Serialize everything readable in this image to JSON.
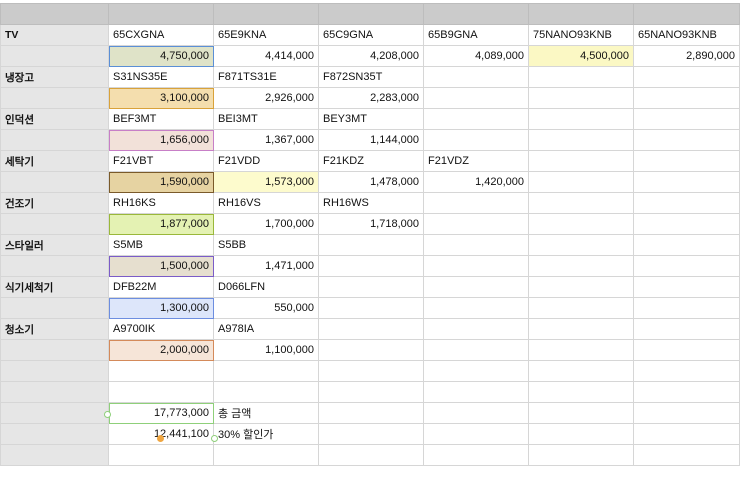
{
  "sheet": {
    "rows": [
      {
        "header": "",
        "cells": [
          "",
          "",
          "",
          "",
          "",
          ""
        ]
      },
      {
        "header": "TV",
        "cells": [
          "65CXGNA",
          "65E9KNA",
          "65C9GNA",
          "65B9GNA",
          "75NANO93KNB",
          "65NANO93KNB"
        ]
      },
      {
        "header": "",
        "cells": [
          "4,750,000",
          "4,414,000",
          "4,208,000",
          "4,089,000",
          "4,500,000",
          "2,890,000"
        ]
      },
      {
        "header": "냉장고",
        "cells": [
          "S31NS35E",
          "F871TS31E",
          "F872SN35T",
          "",
          "",
          ""
        ]
      },
      {
        "header": "",
        "cells": [
          "3,100,000",
          "2,926,000",
          "2,283,000",
          "",
          "",
          ""
        ]
      },
      {
        "header": "인덕션",
        "cells": [
          "BEF3MT",
          "BEI3MT",
          "BEY3MT",
          "",
          "",
          ""
        ]
      },
      {
        "header": "",
        "cells": [
          "1,656,000",
          "1,367,000",
          "1,144,000",
          "",
          "",
          ""
        ]
      },
      {
        "header": "세탁기",
        "cells": [
          "F21VBT",
          "F21VDD",
          "F21KDZ",
          "F21VDZ",
          "",
          ""
        ]
      },
      {
        "header": "",
        "cells": [
          "1,590,000",
          "1,573,000",
          "1,478,000",
          "1,420,000",
          "",
          ""
        ]
      },
      {
        "header": "건조기",
        "cells": [
          "RH16KS",
          "RH16VS",
          "RH16WS",
          "",
          "",
          ""
        ]
      },
      {
        "header": "",
        "cells": [
          "1,877,000",
          "1,700,000",
          "1,718,000",
          "",
          "",
          ""
        ]
      },
      {
        "header": "스타일러",
        "cells": [
          "S5MB",
          "S5BB",
          "",
          "",
          "",
          ""
        ]
      },
      {
        "header": "",
        "cells": [
          "1,500,000",
          "1,471,000",
          "",
          "",
          "",
          ""
        ]
      },
      {
        "header": "식기세척기",
        "cells": [
          "DFB22M",
          "D066LFN",
          "",
          "",
          "",
          ""
        ]
      },
      {
        "header": "",
        "cells": [
          "1,300,000",
          "550,000",
          "",
          "",
          "",
          ""
        ]
      },
      {
        "header": "청소기",
        "cells": [
          "A9700IK",
          "A978IA",
          "",
          "",
          "",
          ""
        ]
      },
      {
        "header": "",
        "cells": [
          "2,000,000",
          "1,100,000",
          "",
          "",
          "",
          ""
        ]
      },
      {
        "header": "",
        "cells": [
          "",
          "",
          "",
          "",
          "",
          ""
        ]
      },
      {
        "header": "",
        "cells": [
          "",
          "",
          "",
          "",
          "",
          ""
        ]
      },
      {
        "header": "",
        "cells": [
          "17,773,000",
          "총 금액",
          "",
          "",
          "",
          ""
        ]
      },
      {
        "header": "",
        "cells": [
          "12,441,100",
          "30% 할인가",
          "",
          "",
          "",
          ""
        ]
      },
      {
        "header": "",
        "cells": [
          "",
          "",
          "",
          "",
          "",
          ""
        ]
      }
    ]
  },
  "colors": {
    "tv_selected": "#dfe3c8",
    "tv_75nano": "#fbf8c4",
    "fridge_selected": "#f4deae",
    "induction_selected": "#f2e1d9",
    "washer_selected": "#e6d3a2",
    "washer_second": "#fdfbcd",
    "dryer_selected": "#e4f2b3",
    "styler_selected": "#e6dfcf",
    "dishwasher_selected": "#dde6fa",
    "vacuum_selected": "#f6e5d8"
  }
}
